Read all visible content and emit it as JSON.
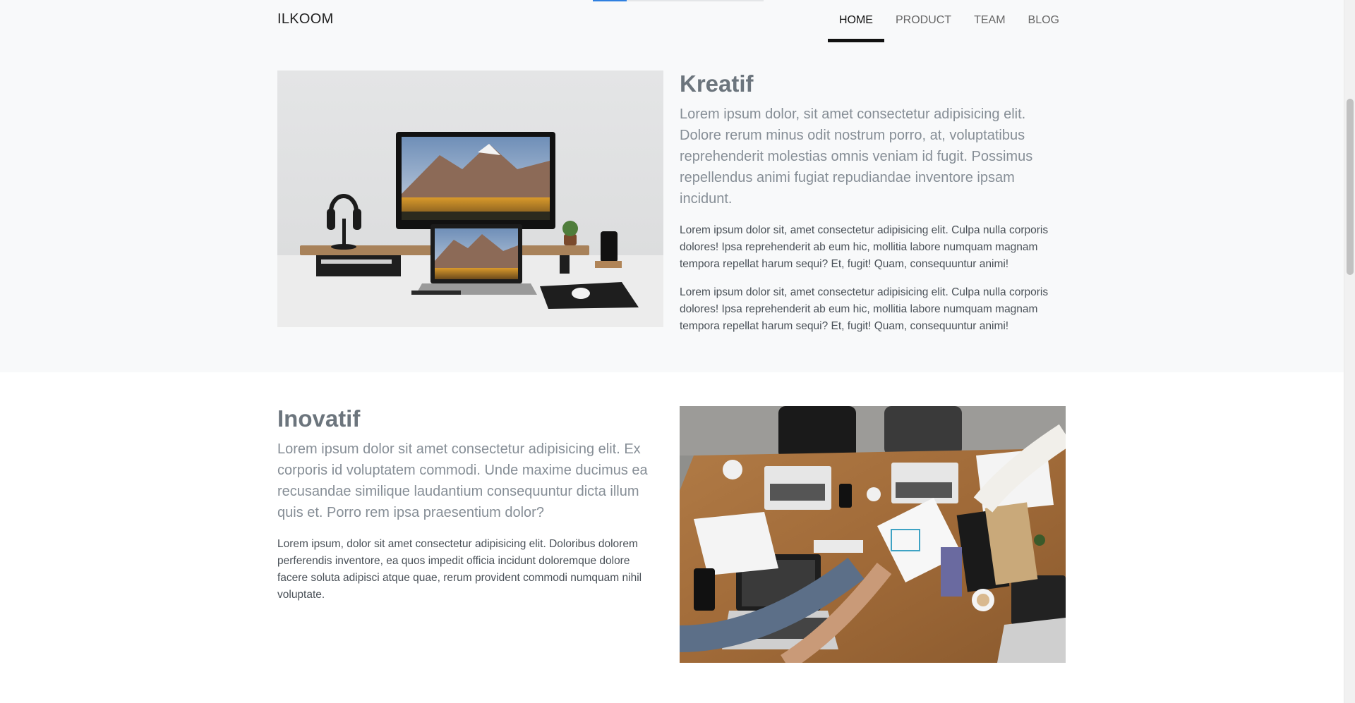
{
  "nav": {
    "brand": "ILKOOM",
    "links": [
      "HOME",
      "PRODUCT",
      "TEAM",
      "BLOG"
    ],
    "active_index": 0,
    "scroll_progress_fraction": 0.2
  },
  "sections": {
    "kreatif": {
      "title": "Kreatif",
      "lead": "Lorem ipsum dolor, sit amet consectetur adipisicing elit. Dolore rerum minus odit nostrum porro, at, voluptatibus reprehenderit molestias omnis veniam id fugit. Possimus repellendus animi fugiat repudiandae inventore ipsam incidunt.",
      "paragraphs": [
        "Lorem ipsum dolor sit, amet consectetur adipisicing elit. Culpa nulla corporis dolores! Ipsa reprehenderit ab eum hic, mollitia labore numquam magnam tempora repellat harum sequi? Et, fugit! Quam, consequuntur animi!",
        "Lorem ipsum dolor sit, amet consectetur adipisicing elit. Culpa nulla corporis dolores! Ipsa reprehenderit ab eum hic, mollitia labore numquam magnam tempora repellat harum sequi? Et, fugit! Quam, consequuntur animi!"
      ],
      "image_icon": "desk-workspace-image"
    },
    "inovatif": {
      "title": "Inovatif",
      "lead": "Lorem ipsum dolor sit amet consectetur adipisicing elit. Ex corporis id voluptatem commodi. Unde maxime ducimus ea recusandae similique laudantium consequuntur dicta illum quis et. Porro rem ipsa praesentium dolor?",
      "paragraphs": [
        "Lorem ipsum, dolor sit amet consectetur adipisicing elit. Doloribus dolorem perferendis inventore, ea quos impedit officia incidunt doloremque dolore facere soluta adipisci atque quae, rerum provident commodi numquam nihil voluptate."
      ],
      "image_icon": "team-meeting-image"
    }
  },
  "colors": {
    "accent": "#2f80e0",
    "section_bg": "#f8f9fa",
    "heading": "#6c757d"
  }
}
